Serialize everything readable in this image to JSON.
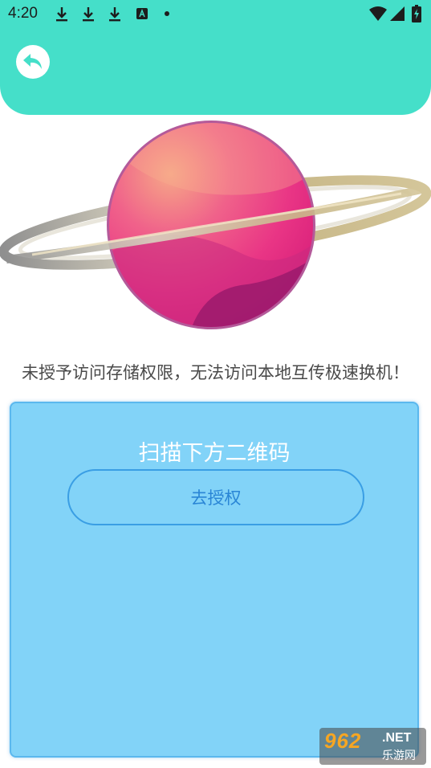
{
  "status_bar": {
    "time": "4:20",
    "icons": [
      "download-icon",
      "download-icon",
      "download-icon",
      "a-box-icon",
      "dot-icon",
      "wifi-icon",
      "cell-signal-icon",
      "battery-charging-icon"
    ]
  },
  "header": {
    "back_icon": "reply-arrow-icon",
    "background_color": "#45dfc9"
  },
  "illustration": {
    "icon": "planet-illustration"
  },
  "message": {
    "text": "未授予访问存储权限，无法访问本地互传极速换机！"
  },
  "panel": {
    "title": "扫描下方二维码",
    "authorize_label": "去授权",
    "background_color": "#82d3f8"
  },
  "watermark": {
    "number": "962",
    "suffix": ".NET",
    "caption": "乐游网"
  }
}
